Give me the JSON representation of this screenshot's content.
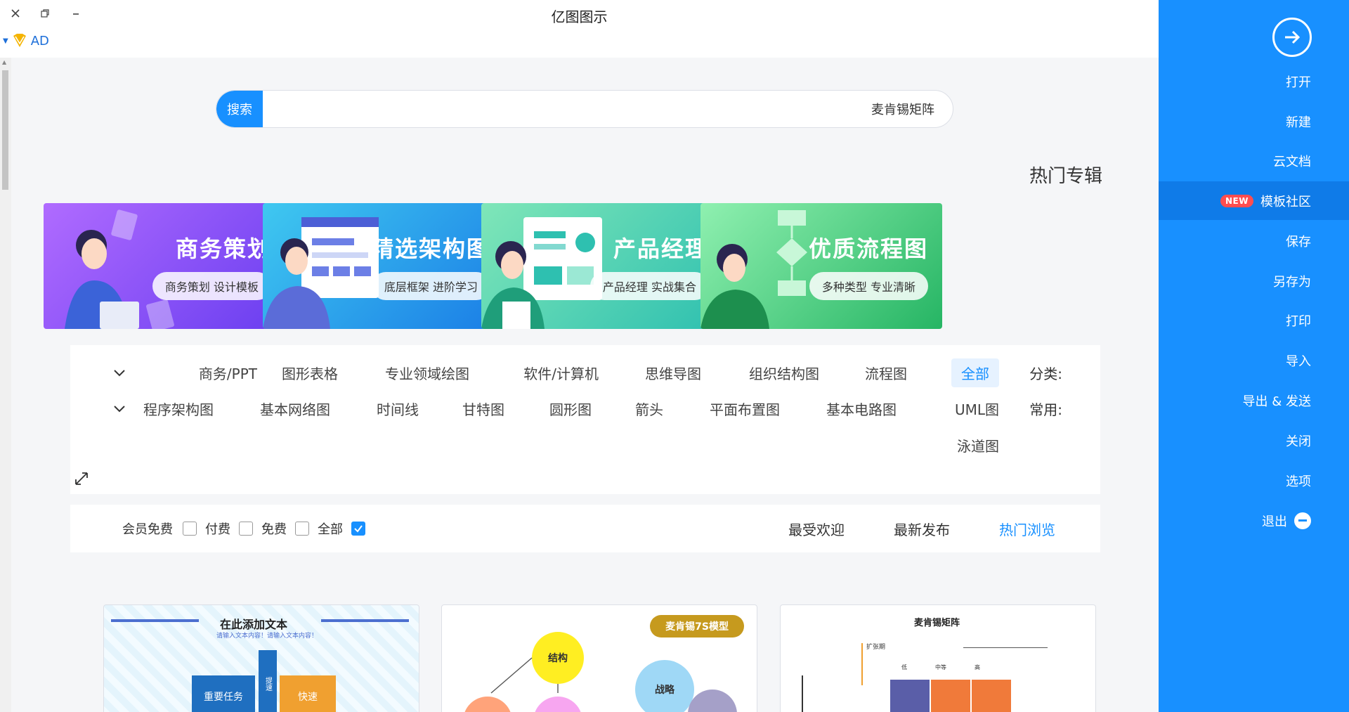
{
  "app": {
    "title": "亿图图示",
    "ad_label": "AD"
  },
  "window": {
    "close": "close",
    "restore": "restore",
    "minimize": "minimize"
  },
  "search": {
    "button": "搜索",
    "value": "麦肯锡矩阵"
  },
  "section_title": "热门专辑",
  "banners": [
    {
      "title": "商务策划",
      "subtitle": "商务策划 设计模板",
      "color": "#7a3ff2"
    },
    {
      "title": "精选架构图",
      "subtitle": "底层框架 进阶学习",
      "color": "#1f8fe8"
    },
    {
      "title": "产品经理",
      "subtitle": "产品经理 实战集合",
      "color": "#35c7a5"
    },
    {
      "title": "优质流程图",
      "subtitle": "多种类型 专业清晰",
      "color": "#2cc270"
    }
  ],
  "filters": {
    "category_label": "分类:",
    "categories": [
      "全部",
      "流程图",
      "组织结构图",
      "思维导图",
      "软件/计算机",
      "专业领域绘图",
      "图形表格",
      "商务/PPT"
    ],
    "common_label": "常用:",
    "common": [
      "UML图",
      "基本电路图",
      "平面布置图",
      "箭头",
      "圆形图",
      "甘特图",
      "时间线",
      "基本网络图",
      "程序架构图",
      "泳道图"
    ]
  },
  "sort": {
    "tabs": [
      "热门浏览",
      "最新发布",
      "最受欢迎"
    ],
    "checkboxes": [
      "全部",
      "免费",
      "付费",
      "会员免费"
    ]
  },
  "cards": [
    {
      "title": "在此添加文本",
      "sub": "请输入文本内容！请输入文本内容！",
      "blocks": [
        "重要任务",
        "快速",
        "提速"
      ]
    },
    {
      "title": "麦肯锡7S模型",
      "nodes": [
        "结构",
        "战略"
      ]
    },
    {
      "title": "麦肯锡矩阵",
      "notes": [
        "扩张期",
        "低",
        "中等",
        "高"
      ]
    }
  ],
  "sidebar": {
    "open": "打开",
    "items": [
      "新建",
      "云文档",
      "模板社区",
      "保存",
      "另存为",
      "打印",
      "导入",
      "导出 & 发送",
      "关闭",
      "选项",
      "退出"
    ],
    "new_badge": "NEW"
  },
  "colors": {
    "accent": "#1890ff",
    "sidebar": "#1890ff"
  }
}
